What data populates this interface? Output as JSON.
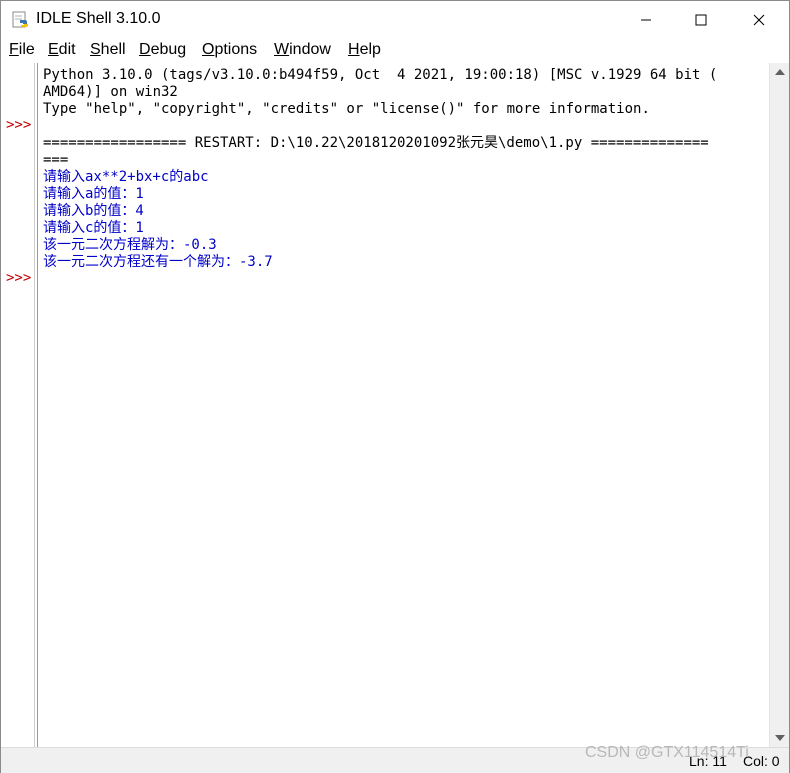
{
  "window": {
    "title": "IDLE Shell 3.10.0"
  },
  "menu": {
    "items": [
      {
        "label": "File",
        "ul": "F",
        "rest": "ile"
      },
      {
        "label": "Edit",
        "ul": "E",
        "rest": "dit"
      },
      {
        "label": "Shell",
        "ul": "S",
        "rest": "hell"
      },
      {
        "label": "Debug",
        "ul": "D",
        "rest": "ebug"
      },
      {
        "label": "Options",
        "ul": "O",
        "rest": "ptions"
      },
      {
        "label": "Window",
        "ul": "W",
        "rest": "indow"
      },
      {
        "label": "Help",
        "ul": "H",
        "rest": "elp"
      }
    ]
  },
  "shell": {
    "prompts": [
      ">>>",
      ">>>"
    ],
    "lines": [
      {
        "text": "Python 3.10.0 (tags/v3.10.0:b494f59, Oct  4 2021, 19:00:18) [MSC v.1929 64 bit (",
        "kind": "out"
      },
      {
        "text": "AMD64)] on win32",
        "kind": "out"
      },
      {
        "text": "Type \"help\", \"copyright\", \"credits\" or \"license()\" for more information.",
        "kind": "out"
      },
      {
        "text": "",
        "kind": "out"
      },
      {
        "text": "================= RESTART: D:\\10.22\\2018120201092张元昊\\demo\\1.py ==============",
        "kind": "out"
      },
      {
        "text": "===",
        "kind": "out"
      },
      {
        "text": "请输入ax**2+bx+c的abc",
        "kind": "usr"
      },
      {
        "text": "请输入a的值：1",
        "kind": "usr"
      },
      {
        "text": "请输入b的值：4",
        "kind": "usr"
      },
      {
        "text": "请输入c的值：1",
        "kind": "usr"
      },
      {
        "text": "该一元二次方程解为：-0.3",
        "kind": "usr"
      },
      {
        "text": "该一元二次方程还有一个解为：-3.7",
        "kind": "usr"
      }
    ]
  },
  "status": {
    "ln": "Ln: 11",
    "col": "Col: 0"
  },
  "watermark": "CSDN @GTX114514Ti",
  "colors": {
    "prompt": "#c00000",
    "user_output": "#0000c8",
    "output": "#000000"
  }
}
